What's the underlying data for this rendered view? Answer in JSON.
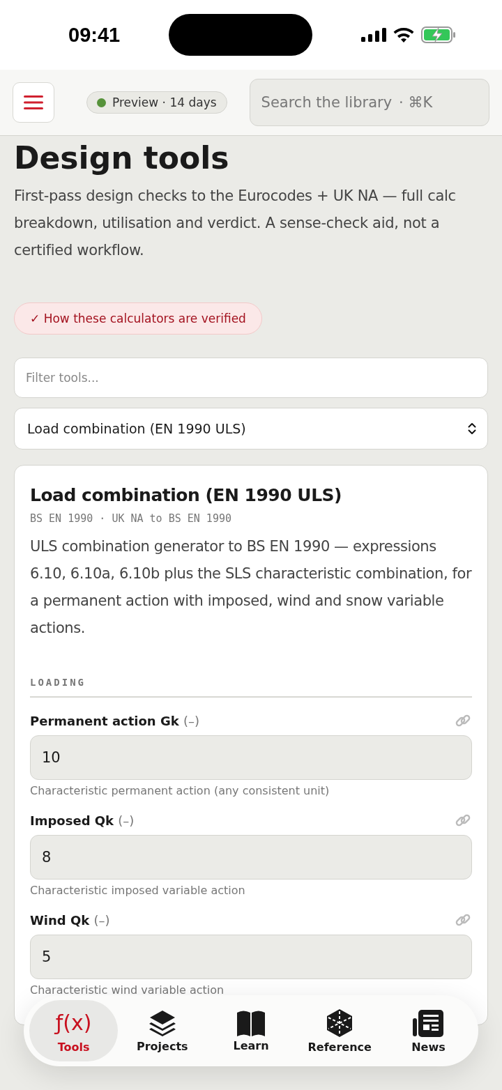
{
  "status_bar": {
    "time": "09:41"
  },
  "header": {
    "badge": "Preview · 14 days",
    "search": {
      "placeholder": "Search the library",
      "shortcut": "· ⌘K"
    }
  },
  "page": {
    "title": "Design tools",
    "intro": "First-pass design checks to the Eurocodes + UK NA — full calc breakdown, utilisation and verdict. A sense-check aid, not a certified workflow.",
    "verified_link": "✓ How these calculators are verified"
  },
  "filter": {
    "placeholder": "Filter tools..."
  },
  "tool_select": {
    "value": "Load combination (EN 1990 ULS)"
  },
  "card": {
    "title": "Load combination (EN 1990 ULS)",
    "standards": "BS EN 1990 · UK NA to BS EN 1990",
    "description": "ULS combination generator to BS EN 1990 — expressions 6.10, 6.10a, 6.10b plus the SLS characteristic combination, for a permanent action with imposed, wind and snow variable actions.",
    "section": "LOADING",
    "fields": [
      {
        "label": "Permanent action Gk",
        "unit": "(–)",
        "value": "10",
        "hint": "Characteristic permanent action (any consistent unit)"
      },
      {
        "label": "Imposed Qk",
        "unit": "(–)",
        "value": "8",
        "hint": "Characteristic imposed variable action"
      },
      {
        "label": "Wind Qk",
        "unit": "(–)",
        "value": "5",
        "hint": "Characteristic wind variable action"
      }
    ]
  },
  "tab_bar": [
    {
      "label": "Tools",
      "glyph": "ƒ(x)",
      "selected": true
    },
    {
      "label": "Projects",
      "selected": false
    },
    {
      "label": "Learn",
      "selected": false
    },
    {
      "label": "Reference",
      "selected": false
    },
    {
      "label": "News",
      "selected": false
    }
  ]
}
